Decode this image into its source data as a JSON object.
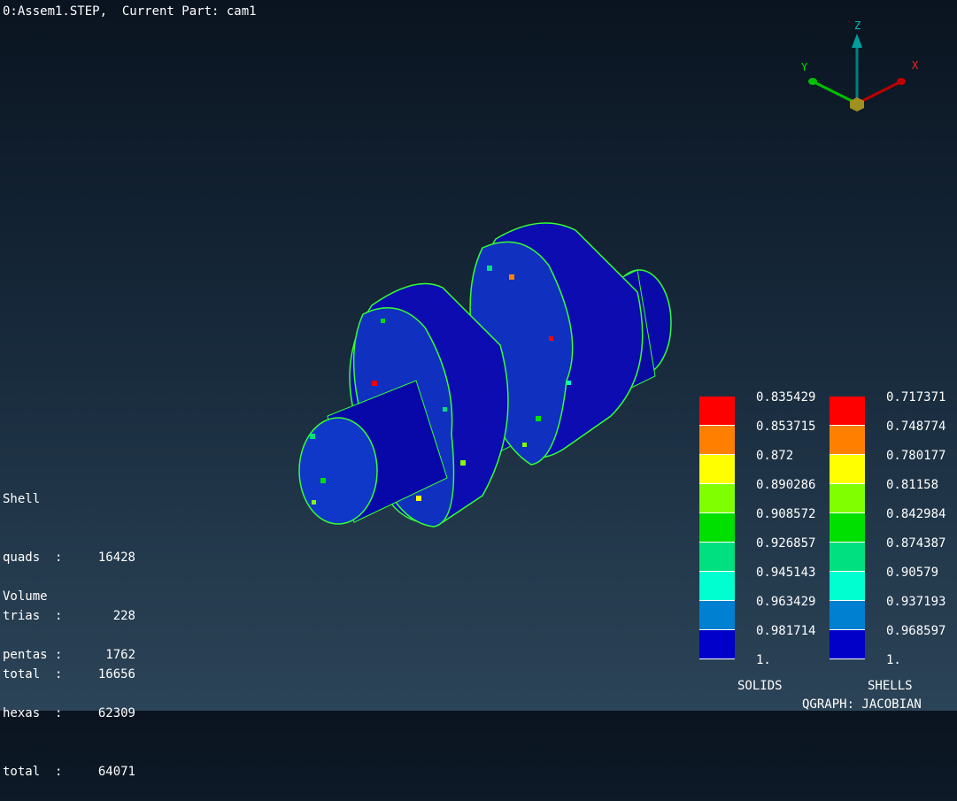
{
  "header": "0:Assem1.STEP,  Current Part: cam1",
  "shell": {
    "title": "Shell",
    "rows": [
      {
        "label": "quads  :",
        "value": "16428"
      },
      {
        "label": "trias  :",
        "value": "228"
      },
      {
        "label": "total  :",
        "value": "16656"
      }
    ]
  },
  "volume": {
    "title": "Volume",
    "rows": [
      {
        "label": "pentas :",
        "value": "1762"
      },
      {
        "label": "hexas  :",
        "value": "62309"
      },
      {
        "label": "total  :",
        "value": "64071"
      }
    ]
  },
  "axes": {
    "x": "X",
    "y": "Y",
    "z": "Z"
  },
  "legend": {
    "colors": [
      "#ff0000",
      "#ff8000",
      "#ffff00",
      "#80ff00",
      "#00e000",
      "#00e080",
      "#00ffd0",
      "#0080d0",
      "#0000c8"
    ],
    "solids": {
      "title": "SOLIDS",
      "values": [
        "0.835429",
        "0.853715",
        "0.872",
        "0.890286",
        "0.908572",
        "0.926857",
        "0.945143",
        "0.963429",
        "0.981714",
        "1."
      ]
    },
    "shells": {
      "title": "SHELLS",
      "values": [
        "0.717371",
        "0.748774",
        "0.780177",
        "0.81158",
        "0.842984",
        "0.874387",
        "0.90579",
        "0.937193",
        "0.968597",
        "1."
      ]
    }
  },
  "footer": "QGRAPH: JACOBIAN"
}
